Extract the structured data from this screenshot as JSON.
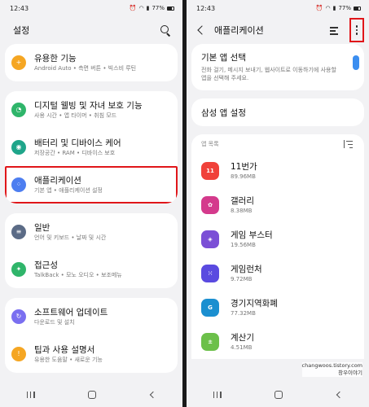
{
  "left": {
    "status": {
      "time": "12:43",
      "battery": "77%"
    },
    "title": "설정",
    "groups": [
      [
        {
          "title": "유용한 기능",
          "subtitle": "Android Auto  •  측면 버튼  •  빅스비 루틴",
          "color": "#f5a623",
          "glyph": "+"
        }
      ],
      [
        {
          "title": "디지털 웰빙 및 자녀 보호 기능",
          "subtitle": "사용 시간  •  앱 타이머  •  취침 모드",
          "color": "#2fb56a",
          "glyph": "◔"
        },
        {
          "title": "배터리 및 디바이스 케어",
          "subtitle": "저장공간  •  RAM  •  디바이스 보호",
          "color": "#1fa58a",
          "glyph": "◉"
        },
        {
          "title": "애플리케이션",
          "subtitle": "기본 앱  •  애플리케이션 설정",
          "color": "#4d7ef0",
          "glyph": "⁘"
        }
      ],
      [
        {
          "title": "일반",
          "subtitle": "언어 및 키보드  •  날짜 및 시간",
          "color": "#5b6b86",
          "glyph": "≡"
        },
        {
          "title": "접근성",
          "subtitle": "TalkBack  •  모노 오디오  •  보조메뉴",
          "color": "#2fb56a",
          "glyph": "✦"
        }
      ],
      [
        {
          "title": "소프트웨어 업데이트",
          "subtitle": "다운로드 및 설치",
          "color": "#7a6ff0",
          "glyph": "↻"
        },
        {
          "title": "팁과 사용 설명서",
          "subtitle": "유용한 도움말  •  새로운 기능",
          "color": "#f5a623",
          "glyph": "!"
        }
      ]
    ]
  },
  "right": {
    "status": {
      "time": "12:43",
      "battery": "77%"
    },
    "title": "애플리케이션",
    "default_app": {
      "title": "기본 앱 선택",
      "subtitle": "전화 걸기, 메시지 보내기, 웹사이트로 이동하기에 사용할 앱을 선택해 주세요."
    },
    "samsung_settings": "삼성 앱 설정",
    "app_list_label": "앱 목록",
    "apps": [
      {
        "name": "11번가",
        "size": "89.96MB",
        "color": "#f0413a",
        "glyph": "11"
      },
      {
        "name": "갤러리",
        "size": "8.38MB",
        "color": "#d43a8c",
        "glyph": "✿"
      },
      {
        "name": "게임 부스터",
        "size": "19.56MB",
        "color": "#7b4fd6",
        "glyph": "◈"
      },
      {
        "name": "게임런처",
        "size": "9.72MB",
        "color": "#5a4ae0",
        "glyph": "⁙"
      },
      {
        "name": "경기지역화폐",
        "size": "77.32MB",
        "color": "#1b8fd0",
        "glyph": "G"
      },
      {
        "name": "계산기",
        "size": "4.51MB",
        "color": "#6cc04a",
        "glyph": "±"
      }
    ],
    "watermark": {
      "line1": "changwoos.tistory.com",
      "line2": "창우이야기"
    }
  }
}
